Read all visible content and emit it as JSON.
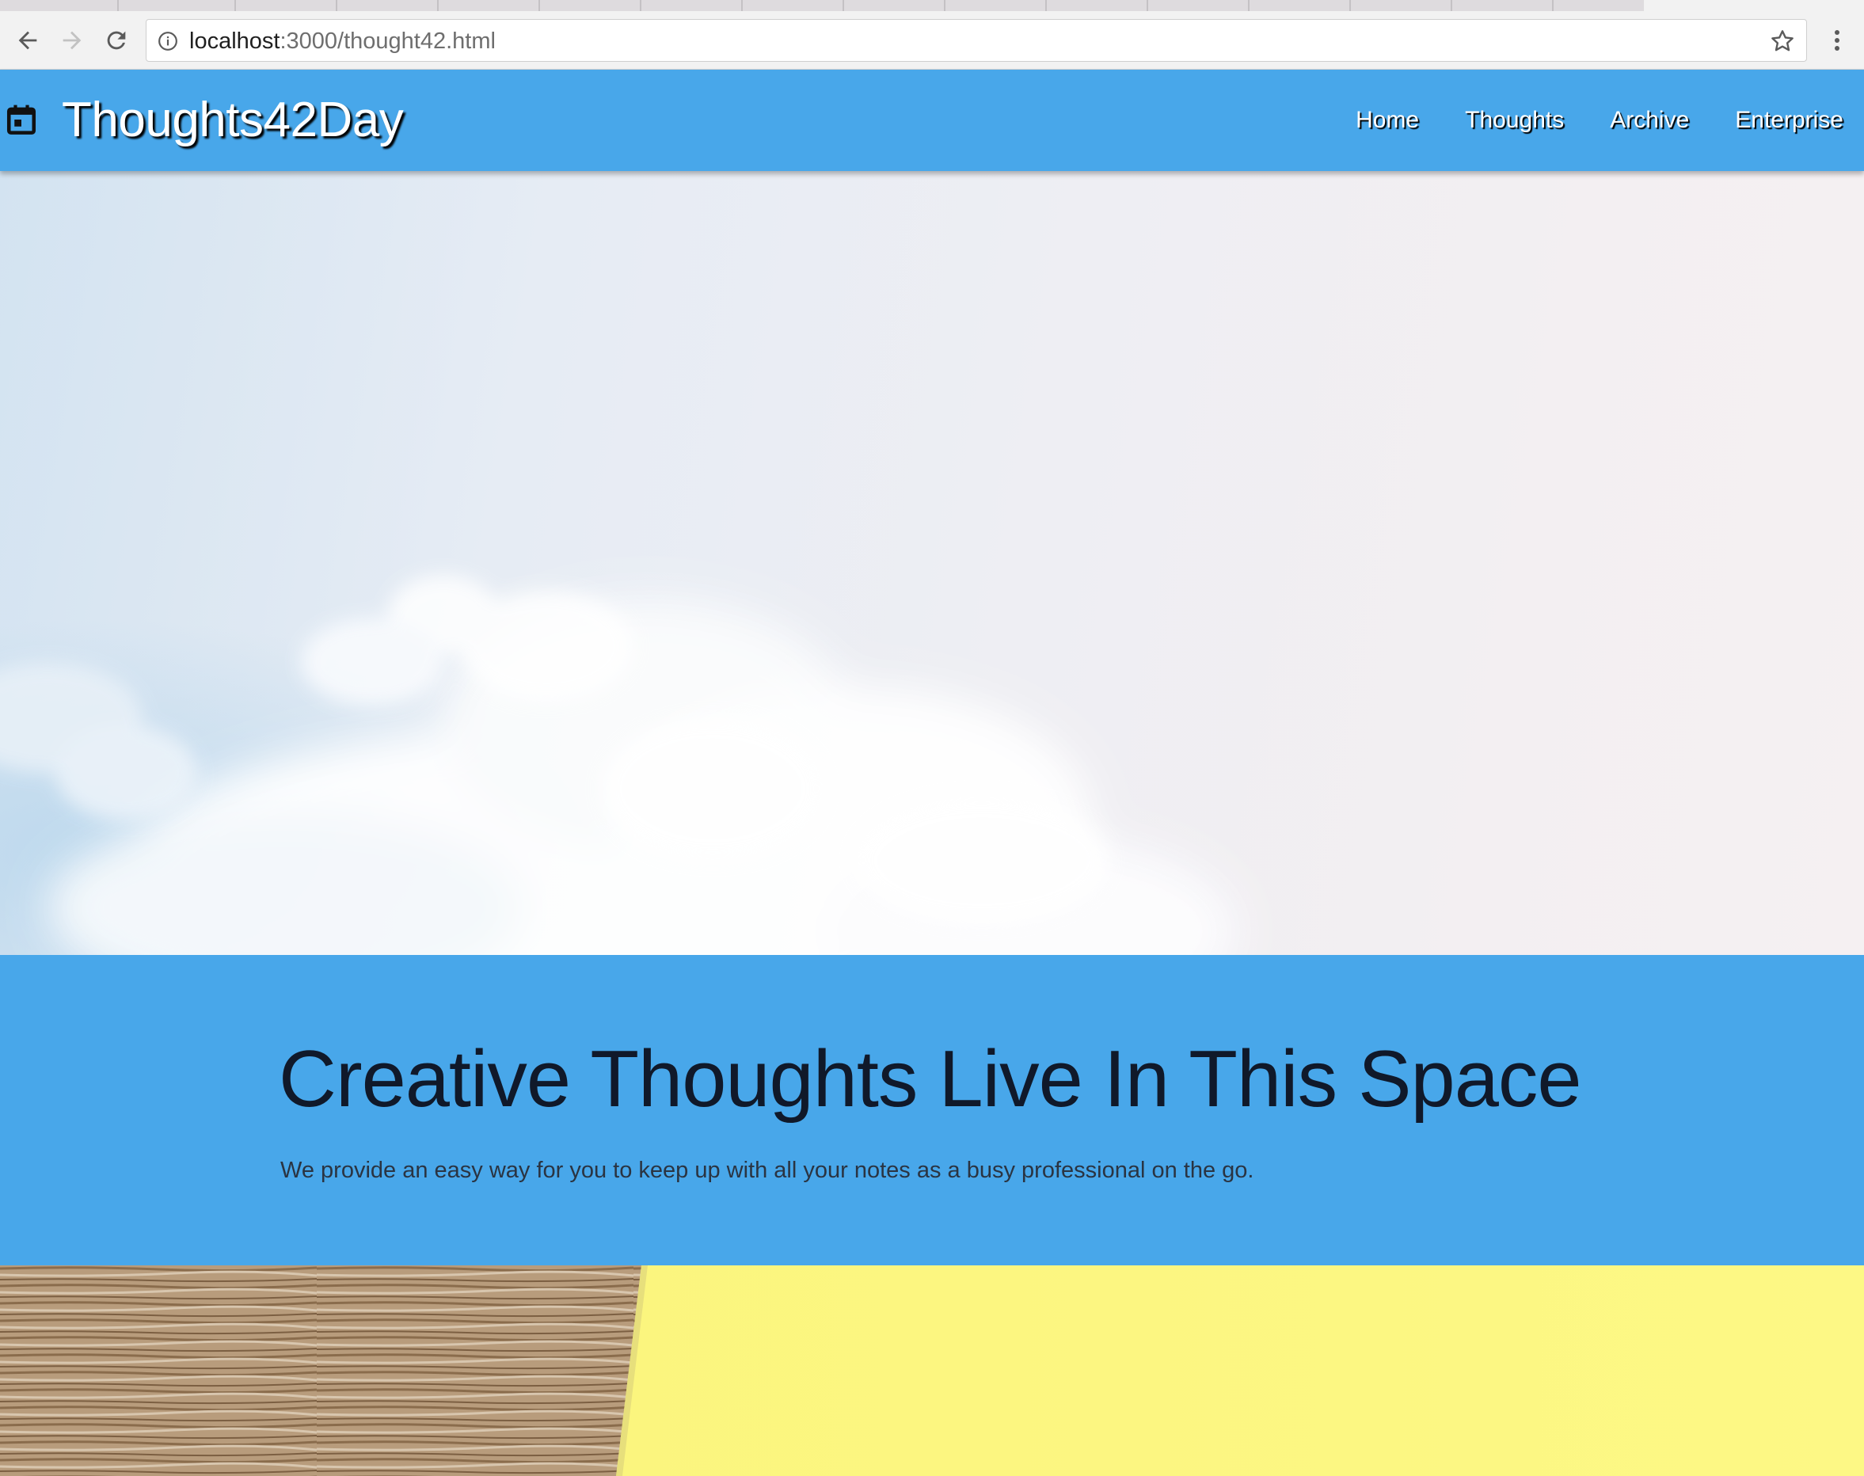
{
  "browser": {
    "url_host": "localhost",
    "url_rest": ":3000/thought42.html",
    "icons": {
      "back": "back-arrow-icon",
      "forward": "forward-arrow-icon",
      "reload": "reload-icon",
      "info": "info-icon",
      "bookmark": "star-icon",
      "menu": "kebab-menu-icon"
    }
  },
  "header": {
    "brand_icon": "calendar-icon",
    "title": "Thoughts42Day",
    "nav": [
      "Home",
      "Thoughts",
      "Archive",
      "Enterprise"
    ]
  },
  "band": {
    "heading": "Creative Thoughts Live In This Space",
    "subtext": "We provide an easy way for you to keep up with all your notes as a busy professional on the go."
  },
  "colors": {
    "header_bg": "#48a7ea",
    "heading_text": "#10192a",
    "sticky_note": "#fbf57d",
    "wood": "#a98c6a"
  }
}
